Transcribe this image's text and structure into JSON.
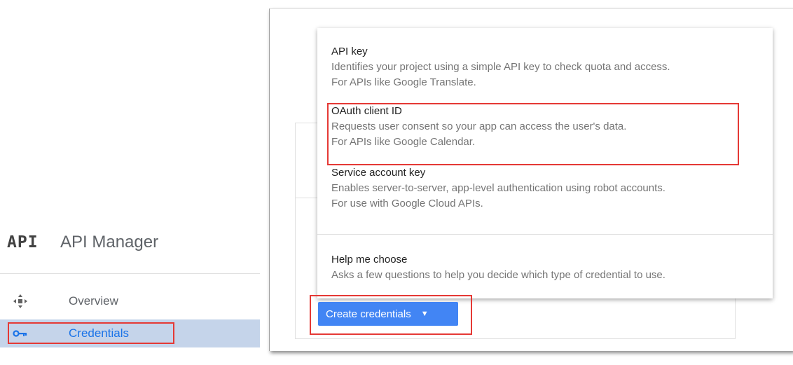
{
  "sidebar": {
    "logo_text": "API",
    "title": "API Manager",
    "items": [
      {
        "label": "Overview",
        "icon": "overview-icon",
        "active": false
      },
      {
        "label": "Credentials",
        "icon": "key-icon",
        "active": true
      }
    ]
  },
  "credentials_menu": {
    "options": [
      {
        "title": "API key",
        "desc1": "Identifies your project using a simple API key to check quota and access.",
        "desc2": "For APIs like Google Translate."
      },
      {
        "title": "OAuth client ID",
        "desc1": "Requests user consent so your app can access the user's data.",
        "desc2": "For APIs like Google Calendar."
      },
      {
        "title": "Service account key",
        "desc1": "Enables server-to-server, app-level authentication using robot accounts.",
        "desc2": "For use with Google Cloud APIs."
      },
      {
        "title": "Help me choose",
        "desc1": "Asks a few questions to help you decide which type of credential to use."
      }
    ]
  },
  "create_button": {
    "label": "Create credentials",
    "caret": "▼"
  },
  "colors": {
    "accent_blue": "#4285f4",
    "active_item_bg": "#c5d4ea",
    "highlight_red": "#e53935"
  }
}
